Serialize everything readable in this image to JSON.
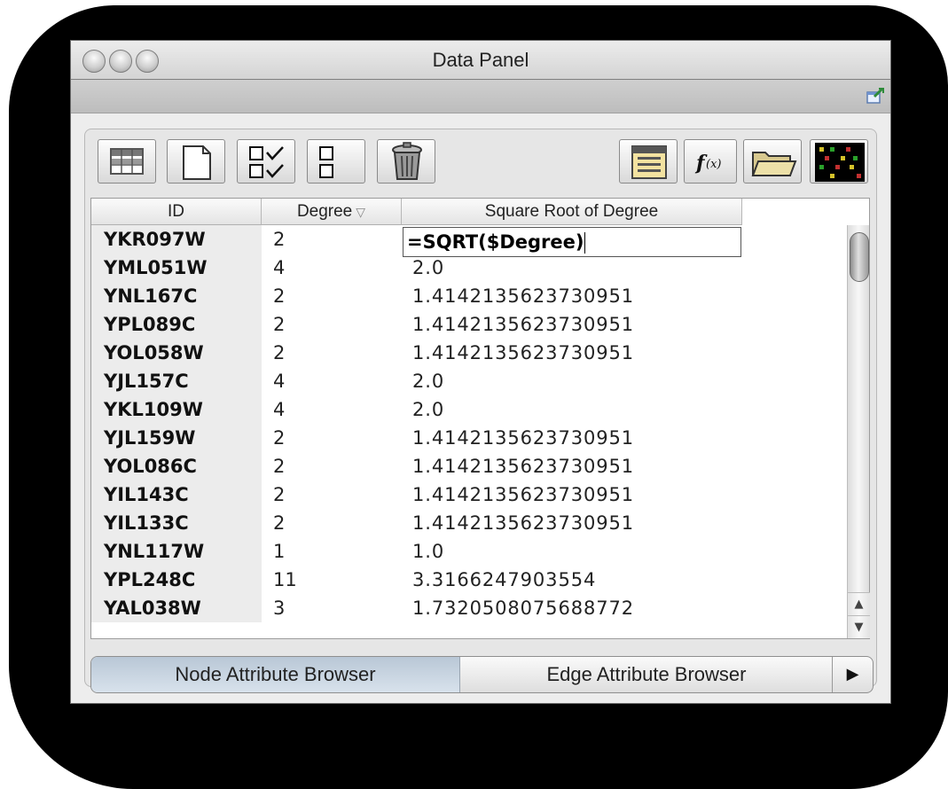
{
  "window": {
    "title": "Data Panel"
  },
  "toolbar": {
    "buttons": [
      {
        "icon": "table-grid-icon"
      },
      {
        "icon": "new-page-icon"
      },
      {
        "icon": "select-all-icon"
      },
      {
        "icon": "deselect-all-icon"
      },
      {
        "icon": "trash-icon"
      },
      {
        "icon": "attribute-list-icon"
      },
      {
        "icon": "function-icon"
      },
      {
        "icon": "open-folder-icon"
      },
      {
        "icon": "heatmap-icon"
      }
    ]
  },
  "table": {
    "columns": [
      "ID",
      "Degree",
      "Square Root of Degree"
    ],
    "sort_icon": "▽",
    "editing_value": "=SQRT($Degree)",
    "rows": [
      {
        "id": "YKR097W",
        "degree": "2",
        "sqrt": ""
      },
      {
        "id": "YML051W",
        "degree": "4",
        "sqrt": "2.0"
      },
      {
        "id": "YNL167C",
        "degree": "2",
        "sqrt": "1.4142135623730951"
      },
      {
        "id": "YPL089C",
        "degree": "2",
        "sqrt": "1.4142135623730951"
      },
      {
        "id": "YOL058W",
        "degree": "2",
        "sqrt": "1.4142135623730951"
      },
      {
        "id": "YJL157C",
        "degree": "4",
        "sqrt": "2.0"
      },
      {
        "id": "YKL109W",
        "degree": "4",
        "sqrt": "2.0"
      },
      {
        "id": "YJL159W",
        "degree": "2",
        "sqrt": "1.4142135623730951"
      },
      {
        "id": "YOL086C",
        "degree": "2",
        "sqrt": "1.4142135623730951"
      },
      {
        "id": "YIL143C",
        "degree": "2",
        "sqrt": "1.4142135623730951"
      },
      {
        "id": "YIL133C",
        "degree": "2",
        "sqrt": "1.4142135623730951"
      },
      {
        "id": "YNL117W",
        "degree": "1",
        "sqrt": "1.0"
      },
      {
        "id": "YPL248C",
        "degree": "11",
        "sqrt": "3.3166247903554"
      },
      {
        "id": "YAL038W",
        "degree": "3",
        "sqrt": "1.7320508075688772"
      }
    ]
  },
  "tabs": {
    "node": "Node Attribute Browser",
    "edge": "Edge Attribute Browser",
    "more": "▶"
  },
  "scroll": {
    "up": "▲",
    "down": "▼"
  }
}
